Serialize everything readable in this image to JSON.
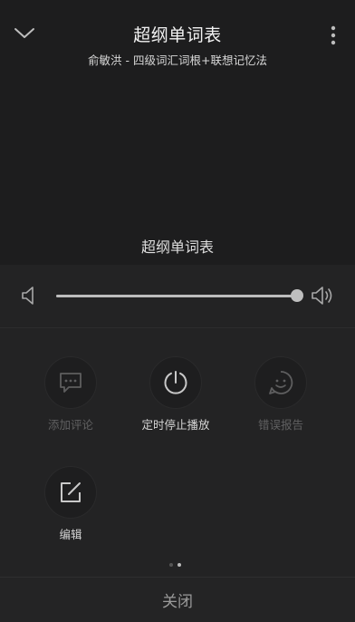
{
  "header": {
    "title": "超纲单词表",
    "subtitle": "俞敏洪 - 四级词汇词根+联想记忆法"
  },
  "now_playing": {
    "track": "超纲单词表"
  },
  "volume": {
    "level": 1.0
  },
  "actions": [
    {
      "label": "添加评论",
      "icon": "comment-icon",
      "enabled": false
    },
    {
      "label": "定时停止播放",
      "icon": "timer-icon",
      "enabled": true
    },
    {
      "label": "错误报告",
      "icon": "smiley-report-icon",
      "enabled": false
    },
    {
      "label": "编辑",
      "icon": "edit-icon",
      "enabled": true
    }
  ],
  "pager": {
    "pages": 2,
    "current": 2
  },
  "close_label": "关闭",
  "colors": {
    "background": "#1b1b1c",
    "panel": "#232324",
    "text": "#e8e8e8",
    "disabled": "#606061"
  }
}
